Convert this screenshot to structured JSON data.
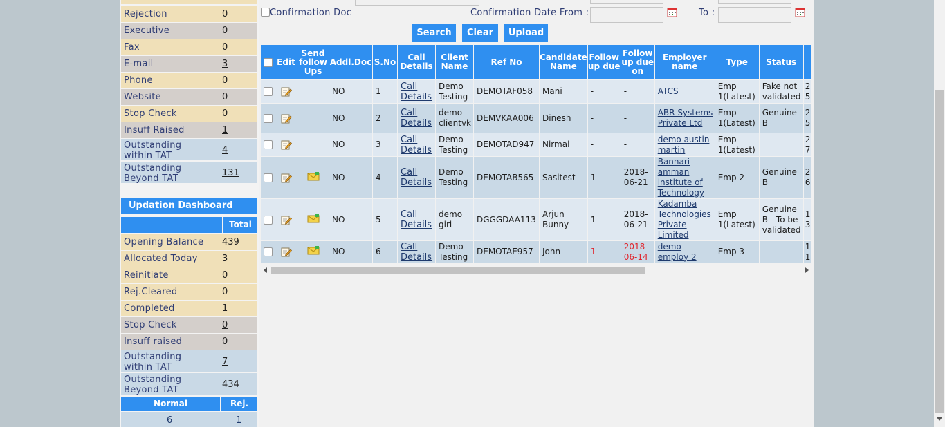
{
  "sidebar": {
    "status_rows": [
      {
        "label": "Rejection",
        "value": "0",
        "link": false,
        "color": "tan"
      },
      {
        "label": "Executive",
        "value": "0",
        "link": false,
        "color": "gray"
      },
      {
        "label": "Fax",
        "value": "0",
        "link": false,
        "color": "tan"
      },
      {
        "label": "E-mail",
        "value": "3",
        "link": true,
        "color": "gray"
      },
      {
        "label": "Phone",
        "value": "0",
        "link": false,
        "color": "tan"
      },
      {
        "label": "Website",
        "value": "0",
        "link": false,
        "color": "gray"
      },
      {
        "label": "Stop Check",
        "value": "0",
        "link": false,
        "color": "tan"
      },
      {
        "label": "Insuff Raised",
        "value": "1",
        "link": true,
        "color": "gray"
      }
    ],
    "outstanding_within": {
      "label": "Outstanding within TAT",
      "value": "4"
    },
    "outstanding_beyond": {
      "label": "Outstanding Beyond TAT",
      "value": "131"
    },
    "updation": {
      "title": "Updation Dashboard",
      "total_header": "Total",
      "rows": [
        {
          "label": "Opening Balance",
          "value": "439",
          "link": false,
          "color": "tan"
        },
        {
          "label": "Allocated Today",
          "value": "3",
          "link": false,
          "color": "tan"
        },
        {
          "label": "Reinitiate",
          "value": "0",
          "link": false,
          "color": "tan"
        },
        {
          "label": "Rej.Cleared",
          "value": "0",
          "link": false,
          "color": "tan"
        },
        {
          "label": "Completed",
          "value": "1",
          "link": true,
          "color": "tan"
        },
        {
          "label": "Stop Check",
          "value": "0",
          "link": true,
          "color": "gray"
        },
        {
          "label": "Insuff raised",
          "value": "0",
          "link": false,
          "color": "gray"
        }
      ],
      "outstanding_within": {
        "label": "Outstanding within TAT",
        "value": "7"
      },
      "outstanding_beyond": {
        "label": "Outstanding Beyond TAT",
        "value": "434"
      },
      "normal_header": "Normal",
      "rej_header": "Rej.",
      "normal_value": "6",
      "rej_value": "1"
    }
  },
  "filters": {
    "confirmation_doc_label": "Confirmation Doc",
    "date_from_label": "Confirmation Date From :",
    "to_label": "To :",
    "date_from_value": "",
    "to_value": ""
  },
  "buttons": {
    "search": "Search",
    "clear": "Clear",
    "upload": "Upload"
  },
  "table": {
    "headers": {
      "edit": "Edit",
      "send_followups": "Send follow Ups",
      "addl_doc": "Addl.Doc",
      "sno": "S.No",
      "call_details": "Call Details",
      "client_name": "Client Name",
      "ref_no": "Ref No",
      "candidate_name": "Candidate Name",
      "followup_due": "Follow up due",
      "followup_due_on": "Follow up due on",
      "employer_name": "Employer name",
      "type": "Type",
      "status": "Status"
    },
    "rows": [
      {
        "addl": "NO",
        "sno": "1",
        "call": "Call Details",
        "client": "Demo Testing",
        "ref": "DEMOTAF058",
        "candidate": "Mani",
        "fu_due": "-",
        "fu_on": "-",
        "employer": "ATCS",
        "type": "Emp 1(Latest)",
        "status": "Fake not validated",
        "extra": "2 5",
        "mail": false,
        "red": false
      },
      {
        "addl": "NO",
        "sno": "2",
        "call": "Call Details",
        "client": "demo clientvk",
        "ref": "DEMVKAA006",
        "candidate": "Dinesh",
        "fu_due": "-",
        "fu_on": "-",
        "employer": "ABR Systems Private Ltd",
        "type": "Emp 1(Latest)",
        "status": "Genuine B",
        "extra": "2 5",
        "mail": false,
        "red": false
      },
      {
        "addl": "NO",
        "sno": "3",
        "call": "Call Details",
        "client": "Demo Testing",
        "ref": "DEMOTAD947",
        "candidate": "Nirmal",
        "fu_due": "-",
        "fu_on": "-",
        "employer": "demo austin martin",
        "type": "Emp 1(Latest)",
        "status": "",
        "extra": "2 7",
        "mail": false,
        "red": false
      },
      {
        "addl": "NO",
        "sno": "4",
        "call": "Call Details",
        "client": "Demo Testing",
        "ref": "DEMOTAB565",
        "candidate": "Sasitest",
        "fu_due": "1",
        "fu_on": "2018-06-21",
        "employer": "Bannari amman institute of Technology",
        "type": "Emp 2",
        "status": "Genuine B",
        "extra": "2 6",
        "mail": true,
        "red": false
      },
      {
        "addl": "NO",
        "sno": "5",
        "call": "Call Details",
        "client": "demo giri",
        "ref": "DGGGDAA113",
        "candidate": "Arjun Bunny",
        "fu_due": "1",
        "fu_on": "2018-06-21",
        "employer": "Kadamba Technologies Private Limited",
        "type": "Emp 1(Latest)",
        "status": "Genuine B - To be validated",
        "extra": "1 3",
        "mail": true,
        "red": false
      },
      {
        "addl": "NO",
        "sno": "6",
        "call": "Call Details",
        "client": "Demo Testing",
        "ref": "DEMOTAE957",
        "candidate": "John",
        "fu_due": "1",
        "fu_on": "2018-06-14",
        "employer": "demo employ 2",
        "type": "Emp 3",
        "status": "",
        "extra": "1 1",
        "mail": true,
        "red": true
      }
    ]
  },
  "colors": {
    "accent": "#2f8ff0",
    "tan": "#f0e0b8",
    "gray": "#d4cfcb",
    "blue": "#c9d9e6",
    "overdue": "#e0262d"
  },
  "icons": [
    "edit-icon",
    "mail-icon",
    "calendar-icon",
    "checkbox"
  ]
}
